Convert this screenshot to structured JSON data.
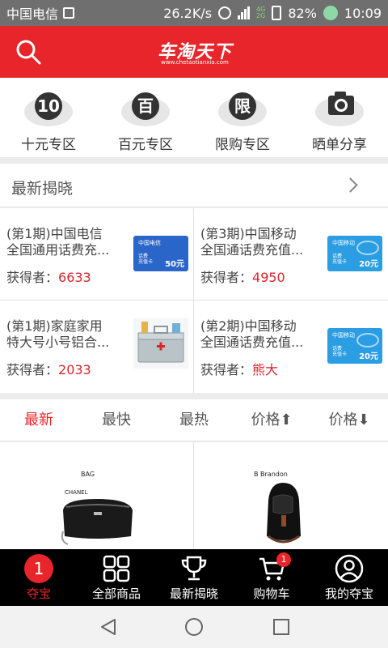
{
  "status_bar": {
    "carrier": "中国电信",
    "speed": "26.2K/s",
    "network": "4G\n2G",
    "battery": "82%",
    "time": "10:09"
  },
  "header": {
    "logo_text": "车淘天下",
    "logo_sub": "www.chetaotianxia.com",
    "brand_color": "#e8252a"
  },
  "categories": [
    {
      "icon": "ten-yuan-icon",
      "glyph": "10",
      "label": "十元专区"
    },
    {
      "icon": "hundred-yuan-icon",
      "glyph": "百",
      "label": "百元专区"
    },
    {
      "icon": "limited-icon",
      "glyph": "限",
      "label": "限购专区"
    },
    {
      "icon": "camera-icon",
      "glyph": "",
      "label": "晒单分享"
    }
  ],
  "latest": {
    "title": "最新揭晓",
    "items": [
      {
        "title1": "(第1期)中国电信",
        "title2": "全国通用话费充...",
        "winner_label": "获得者：",
        "winner": "6633",
        "card": "telecom",
        "card_brand": "中国电信",
        "card_sub": "话费\n充值卡",
        "card_amount": "50元"
      },
      {
        "title1": "(第3期)中国移动",
        "title2": "全国通话费充值...",
        "winner_label": "获得者：",
        "winner": "4950",
        "card": "mobile",
        "card_brand": "中国移动",
        "card_sub": "话费\n充值卡",
        "card_amount": "20元"
      },
      {
        "title1": "(第1期)家庭家用",
        "title2": "特大号小号铝合...",
        "winner_label": "获得者：",
        "winner": "2033",
        "card": "box"
      },
      {
        "title1": "(第2期)中国移动",
        "title2": "全国通话费充值...",
        "winner_label": "获得者：",
        "winner": "熊大",
        "card": "mobile",
        "card_brand": "中国移动",
        "card_sub": "话费\n充值卡",
        "card_amount": "20元"
      }
    ]
  },
  "sort_bar": [
    {
      "label": "最新",
      "active": true
    },
    {
      "label": "最快",
      "active": false
    },
    {
      "label": "最热",
      "active": false
    },
    {
      "label": "价格⬆",
      "active": false
    },
    {
      "label": "价格⬇",
      "active": false
    }
  ],
  "products": [
    {
      "brand": "BAG CHANEL",
      "image": "black-cosmetic-bag"
    },
    {
      "brand": "B Brandon",
      "image": "black-sling-bag"
    }
  ],
  "bottom_nav": [
    {
      "label": "夺宝",
      "icon": "home-icon",
      "glyph": "1",
      "active": true
    },
    {
      "label": "全部商品",
      "icon": "grid-icon",
      "active": false
    },
    {
      "label": "最新揭晓",
      "icon": "trophy-icon",
      "active": false
    },
    {
      "label": "购物车",
      "icon": "cart-icon",
      "badge": "1",
      "active": false
    },
    {
      "label": "我的夺宝",
      "icon": "user-icon",
      "active": false
    }
  ]
}
